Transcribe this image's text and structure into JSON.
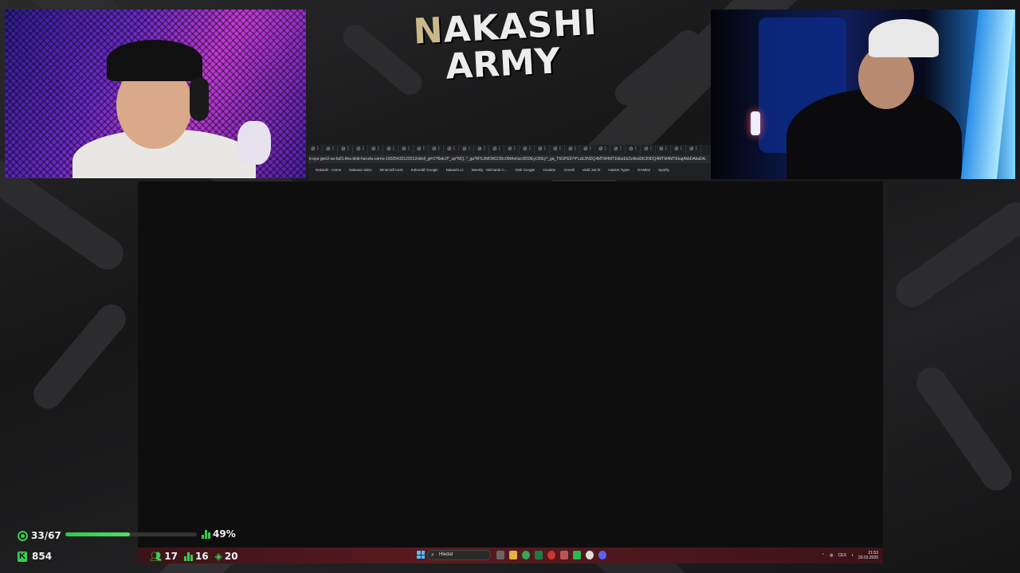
{
  "logo": {
    "line1_first": "N",
    "line1_rest": "AKASHI",
    "line2": "ARMY"
  },
  "browser": {
    "tab_glyph": "⊘ ⁝",
    "url": "ti-ops-gen2-sa-fa01-ifes-bkiti-hai-etu-cerno-19025432120212rdmll_gl=1*f9ok1f*_up*MQ..*_ga*MTc3MDM1ODc0Mi4xNzc0ODEyODEy*_ga_T6GPE074*czE3NDQ4MTM4MTEkbzEkZzAkdDE3NDQ4MTM4MTEkajAkbDAkaDA.",
    "bookmarks": [
      "Nakashi - Home",
      "Nakasui video",
      "Minecraft tools",
      "Kalendář Google",
      "Nakashi.cz",
      "Weekly - Michaela C...",
      "Disk Google",
      "Youtube",
      "Anvelli",
      "Vaild Joe lit",
      "Hacker Typer",
      "GAMEZ",
      "Spotify"
    ]
  },
  "taskbar": {
    "search_placeholder": "Hledat",
    "tray_lang": "CES",
    "clock_time": "21:53",
    "clock_date": "29.03.2026"
  },
  "stats": {
    "goal_current": "33/67",
    "goal_progress": 0.49,
    "percent_label": "49%",
    "kick_followers": "854",
    "viewers": "17",
    "stat_two": "16",
    "stat_three": "20"
  },
  "colors": {
    "accent_green": "#35d04f",
    "taskbar_red": "#5a1a20"
  },
  "icons": [
    "ring-icon",
    "bars-icon",
    "kick-icon",
    "people-icon",
    "flame-icon",
    "windows-start-icon",
    "search-icon"
  ]
}
